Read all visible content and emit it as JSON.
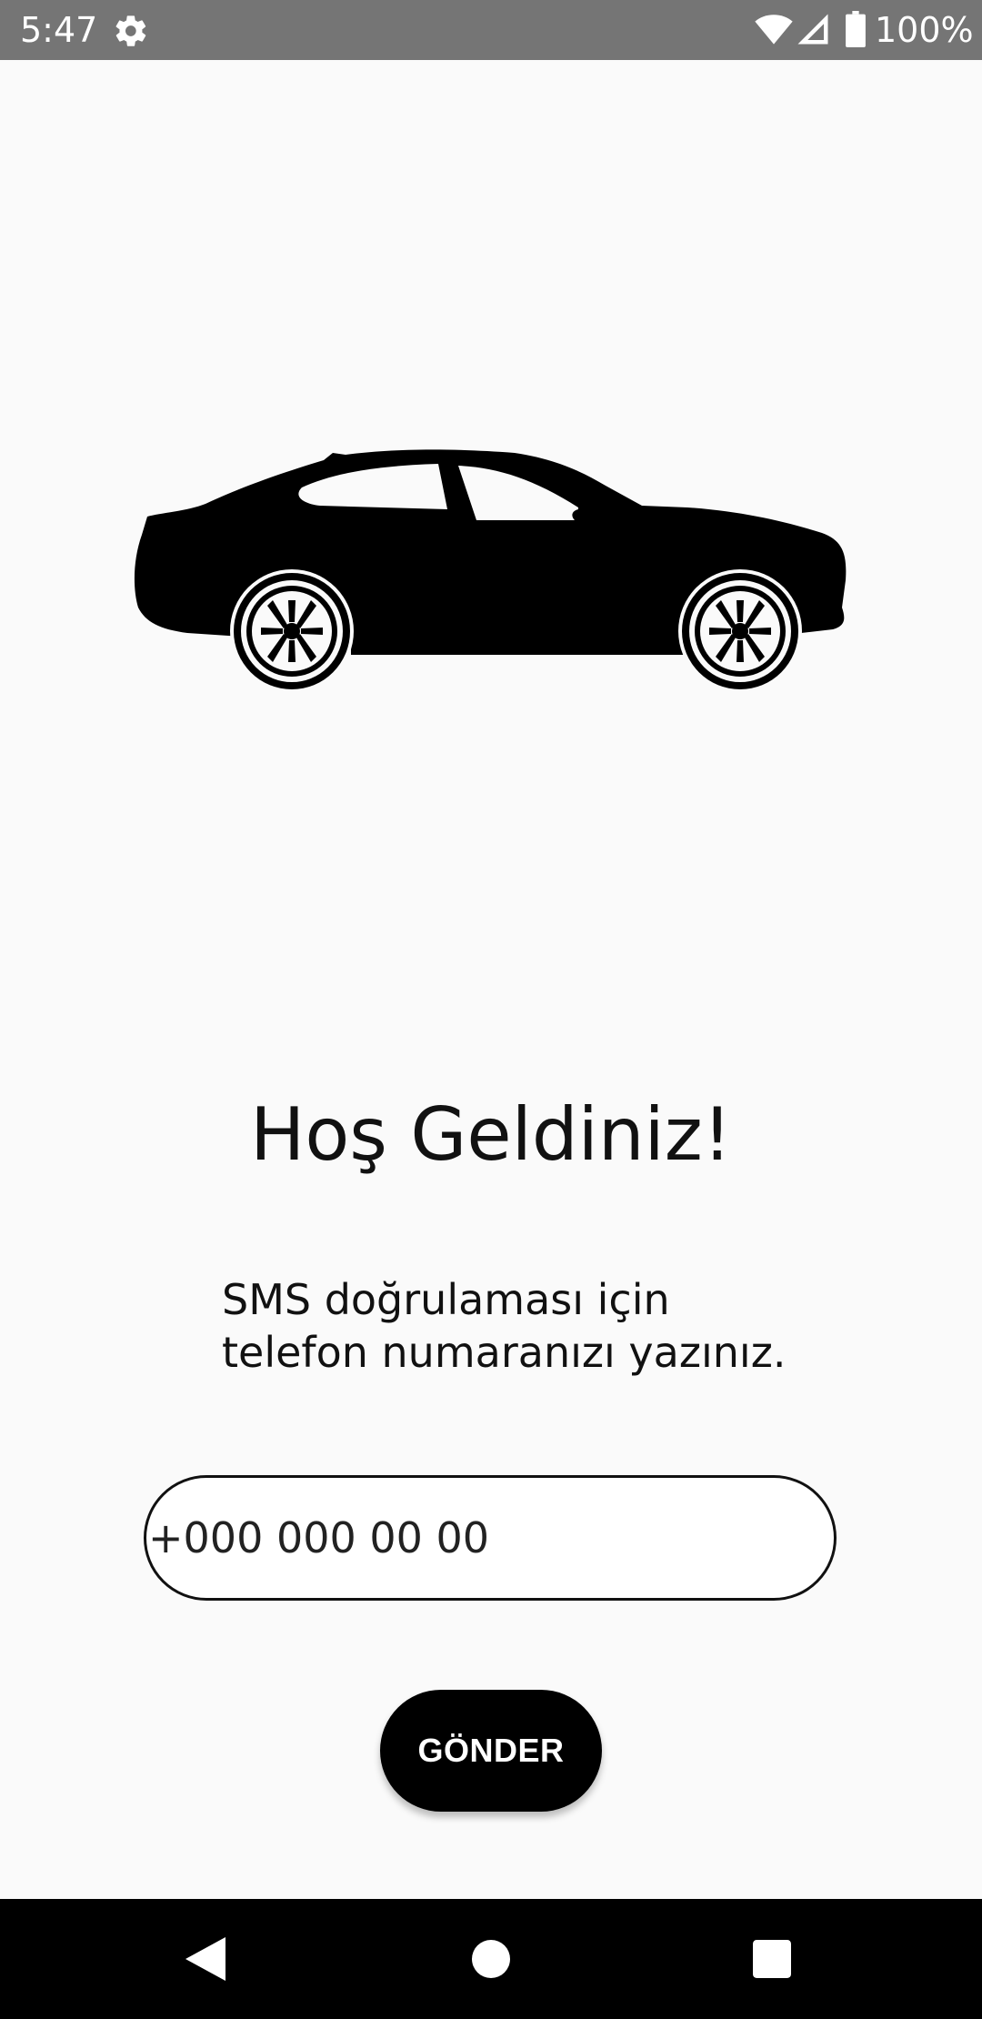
{
  "status_bar": {
    "time": "5:47",
    "battery_text": "100%",
    "icons": [
      "gear-icon",
      "wifi-icon",
      "signal-icon",
      "battery-icon"
    ]
  },
  "illustration": {
    "icon": "car-icon"
  },
  "welcome": {
    "title": "Hoş Geldiniz!"
  },
  "instruction": {
    "line1": "SMS doğrulaması için",
    "line2": "telefon numaranızı yazınız."
  },
  "phone_input": {
    "placeholder": "+000 000 00 00",
    "value": ""
  },
  "send_button": {
    "label": "GÖNDER"
  },
  "nav_bar": {
    "icons": [
      "back-icon",
      "home-icon",
      "recents-icon"
    ]
  },
  "colors": {
    "background": "#fafafa",
    "status_bar": "#757575",
    "button": "#000000",
    "nav_bar": "#000000"
  }
}
